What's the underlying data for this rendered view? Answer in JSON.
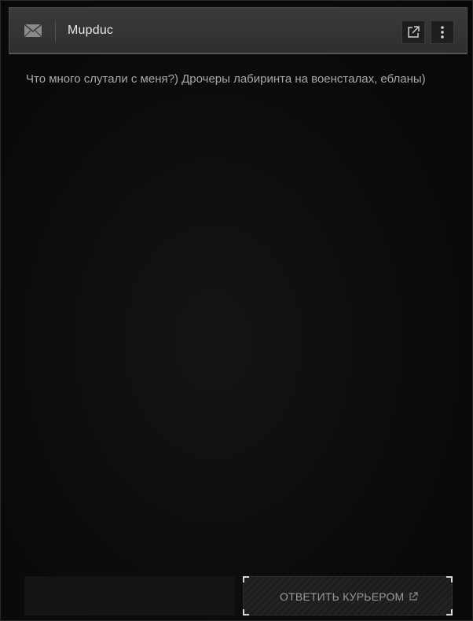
{
  "header": {
    "sender": "Mupduc",
    "icons": {
      "mail": "mail-icon",
      "external": "external-link-icon",
      "menu": "more-vertical-icon"
    }
  },
  "message": {
    "body": "Что много слутали с меня?) Дрочеры лабиринта на военсталах, ебланы)"
  },
  "reply": {
    "input_value": "",
    "button_label": "ОТВЕТИТЬ КУРЬЕРОМ"
  },
  "colors": {
    "header_bg": "#333333",
    "text_primary": "#e6e6e6",
    "text_secondary": "#a9a9a9",
    "accent_corner": "#d8d8d8"
  }
}
